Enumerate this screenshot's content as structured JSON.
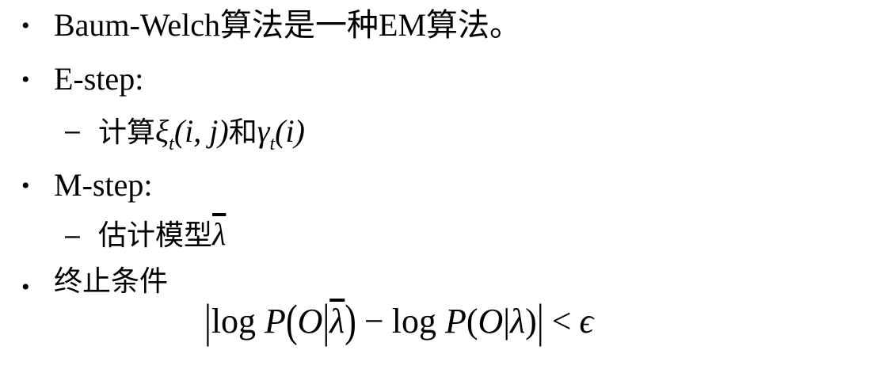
{
  "slide": {
    "items": [
      {
        "marker": "•",
        "text": "Baum-Welch算法是一种EM算法。"
      },
      {
        "marker": "•",
        "text": "E-step:"
      },
      {
        "marker": "–",
        "prefix": "计算",
        "xi": "ξ",
        "xi_sub": "t",
        "xi_args": "(i, j)",
        "mid": "和",
        "gamma": "γ",
        "gamma_sub": "t",
        "gamma_args": "(i)"
      },
      {
        "marker": "•",
        "text": "M-step:"
      },
      {
        "marker": "–",
        "prefix": "估计模型",
        "symbol": "λ"
      },
      {
        "marker": "•",
        "text": "终止条件"
      }
    ],
    "formula": {
      "bar_open": "|",
      "log1": "log",
      "p1": "P",
      "lparen1": "(",
      "o1": "O",
      "cond1": "|",
      "lambda_bar": "λ",
      "rparen1": ")",
      "minus": "−",
      "log2": "log",
      "p2": "P",
      "lparen2": "(",
      "o2": "O",
      "cond2": "|",
      "lambda": "λ",
      "rparen2": ")",
      "bar_close": "|",
      "lt": "<",
      "epsilon": "ϵ"
    }
  }
}
